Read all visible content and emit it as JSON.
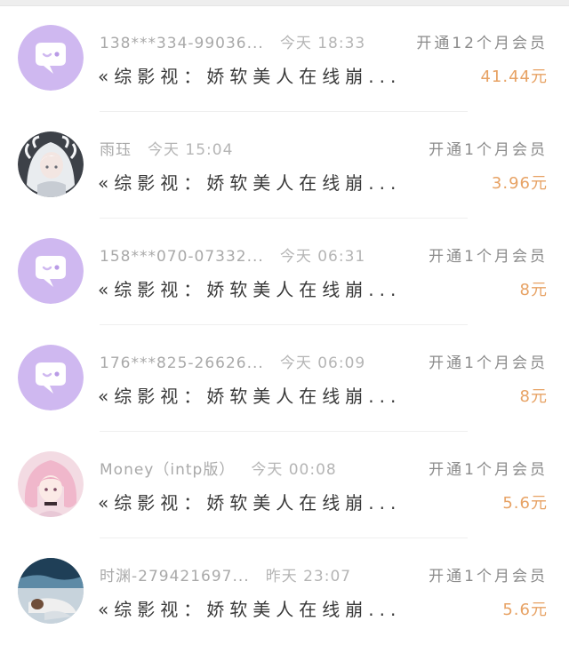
{
  "rows": [
    {
      "name": "138***334-99036...",
      "time": "今天 18:33",
      "plan": "开通12个月会员",
      "title": "«综影视：娇软美人在线崩...",
      "price": "41.44元",
      "avatar": "chat-bubble-icon"
    },
    {
      "name": "雨珏",
      "time": "今天 15:04",
      "plan": "开通1个月会员",
      "title": "«综影视：娇软美人在线崩...",
      "price": "3.96元",
      "avatar": "white-hair-anime-avatar"
    },
    {
      "name": "158***070-07332...",
      "time": "今天 06:31",
      "plan": "开通1个月会员",
      "title": "«综影视：娇软美人在线崩...",
      "price": "8元",
      "avatar": "chat-bubble-icon"
    },
    {
      "name": "176***825-26626...",
      "time": "今天 06:09",
      "plan": "开通1个月会员",
      "title": "«综影视：娇软美人在线崩...",
      "price": "8元",
      "avatar": "chat-bubble-icon"
    },
    {
      "name": "Money（intp版）",
      "time": "今天 00:08",
      "plan": "开通1个月会员",
      "title": "«综影视：娇软美人在线崩...",
      "price": "5.6元",
      "avatar": "pink-hair-anime-avatar"
    },
    {
      "name": "时渊-279421697...",
      "time": "昨天 23:07",
      "plan": "开通1个月会员",
      "title": "«综影视：娇软美人在线崩...",
      "price": "5.6元",
      "avatar": "scenery-avatar"
    }
  ],
  "colors": {
    "price": "#e7a264",
    "avatar_purple": "#cfb8f0",
    "name": "#a9a9a9",
    "title": "#3a3a3a"
  }
}
